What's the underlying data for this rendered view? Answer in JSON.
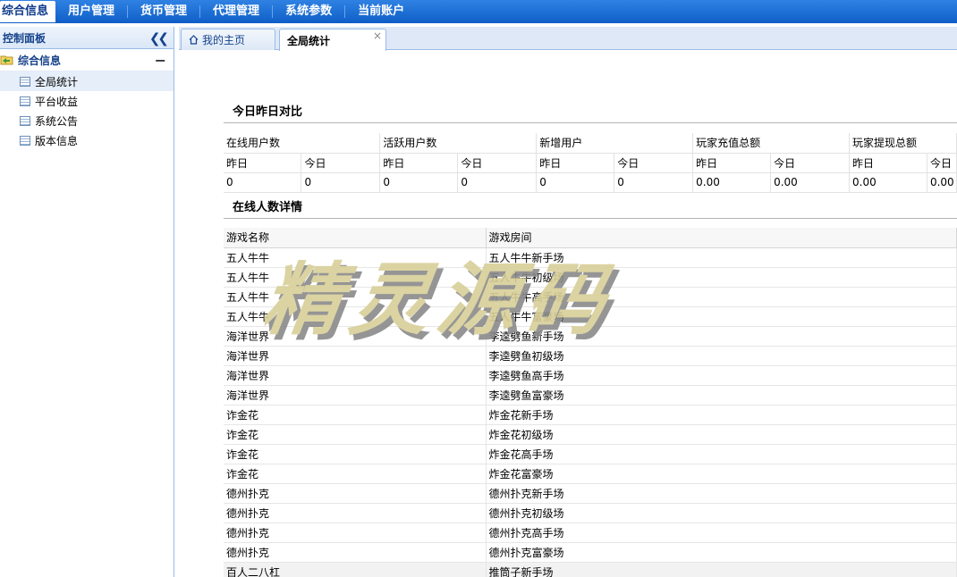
{
  "topnav": {
    "items": [
      "综合信息",
      "用户管理",
      "货币管理",
      "代理管理",
      "系统参数",
      "当前账户"
    ]
  },
  "sidebar": {
    "title": "控制面板",
    "group": "综合信息",
    "items": [
      "全局统计",
      "平台收益",
      "系统公告",
      "版本信息"
    ]
  },
  "tabs": {
    "home": "我的主页",
    "active": "全局统计"
  },
  "compare": {
    "title": "今日昨日对比",
    "headers": [
      "在线用户数",
      "活跃用户数",
      "新增用户",
      "玩家充值总额",
      "玩家提现总额"
    ],
    "yesterday": "昨日",
    "today": "今日",
    "values": [
      [
        "0",
        "0"
      ],
      [
        "0",
        "0"
      ],
      [
        "0",
        "0"
      ],
      [
        "0.00",
        "0.00"
      ],
      [
        "0.00",
        "0.00"
      ]
    ]
  },
  "online": {
    "title": "在线人数详情",
    "columns": [
      "游戏名称",
      "游戏房间"
    ],
    "rows": [
      [
        "五人牛牛",
        "五人牛牛新手场"
      ],
      [
        "五人牛牛",
        "五人牛牛初级场"
      ],
      [
        "五人牛牛",
        "五人牛牛高手场"
      ],
      [
        "五人牛牛",
        "五人牛牛富豪场"
      ],
      [
        "海洋世界",
        "李逵劈鱼新手场"
      ],
      [
        "海洋世界",
        "李逵劈鱼初级场"
      ],
      [
        "海洋世界",
        "李逵劈鱼高手场"
      ],
      [
        "海洋世界",
        "李逵劈鱼富豪场"
      ],
      [
        "诈金花",
        "炸金花新手场"
      ],
      [
        "诈金花",
        "炸金花初级场"
      ],
      [
        "诈金花",
        "炸金花高手场"
      ],
      [
        "诈金花",
        "炸金花富豪场"
      ],
      [
        "德州扑克",
        "德州扑克新手场"
      ],
      [
        "德州扑克",
        "德州扑克初级场"
      ],
      [
        "德州扑克",
        "德州扑克高手场"
      ],
      [
        "德州扑克",
        "德州扑克富豪场"
      ],
      [
        "百人二八杠",
        "推筒子新手场"
      ]
    ]
  },
  "watermark": "精灵源码"
}
